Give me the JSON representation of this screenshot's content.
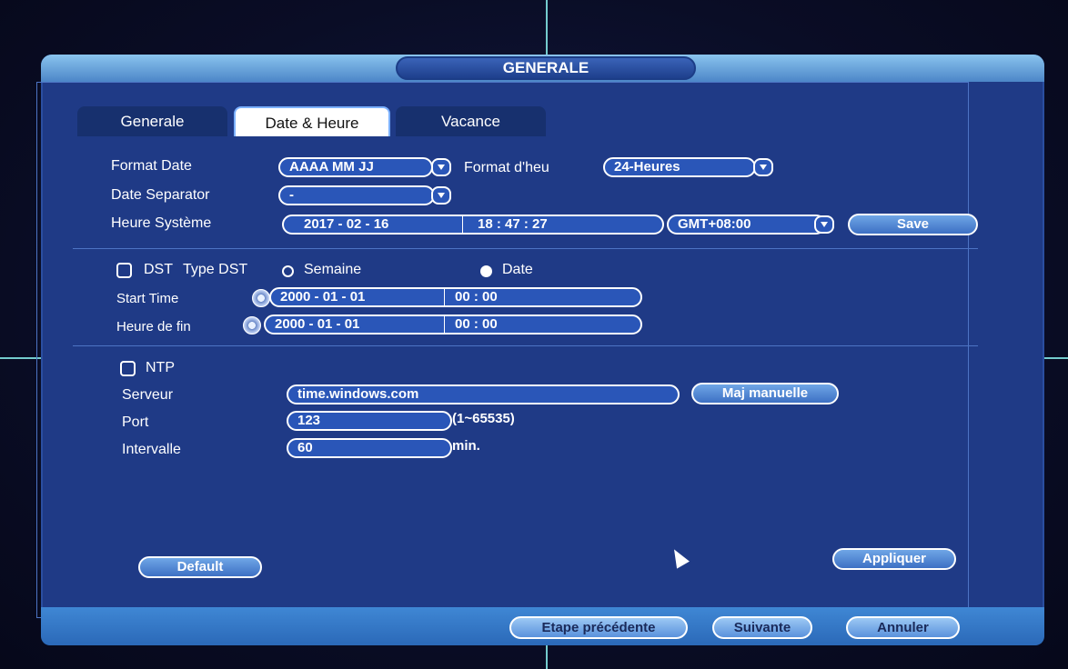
{
  "title": "GENERALE",
  "tabs": [
    "Generale",
    "Date & Heure",
    "Vacance"
  ],
  "date_format": {
    "label": "Format Date",
    "value": "AAAA MM JJ"
  },
  "time_format": {
    "label": "Format d'heu",
    "value": "24-Heures"
  },
  "date_separator": {
    "label": "Date Separator",
    "value": "-"
  },
  "system_time": {
    "label": "Heure Système",
    "date": "2017 - 02 - 16",
    "time": "18 : 47 : 27",
    "timezone": "GMT+08:00",
    "save_label": "Save"
  },
  "dst": {
    "label": "DST",
    "type_label": "Type DST",
    "option_week": "Semaine",
    "option_date": "Date",
    "selected": "Date",
    "enabled": false
  },
  "start_time": {
    "label": "Start Time",
    "date": "2000  - 01 - 01",
    "time": "00 : 00"
  },
  "end_time": {
    "label": "Heure de fin",
    "date": "2000  - 01 - 01",
    "time": "00 : 00"
  },
  "ntp": {
    "label": "NTP",
    "enabled": false,
    "server_label": "Serveur",
    "server_value": "time.windows.com",
    "manual_update_label": "Maj manuelle",
    "port_label": "Port",
    "port_value": "123",
    "port_range": "(1~65535)",
    "interval_label": "Intervalle",
    "interval_value": "60",
    "interval_unit": "min."
  },
  "buttons": {
    "default": "Default",
    "apply": "Appliquer"
  },
  "footer": {
    "prev": "Etape précédente",
    "next": "Suivante",
    "cancel": "Annuler"
  },
  "colors": {
    "panel": "#1f3a86",
    "titlebar": "#8ac4ee",
    "field": "#2a56b8",
    "footer": "#3f87d4"
  }
}
